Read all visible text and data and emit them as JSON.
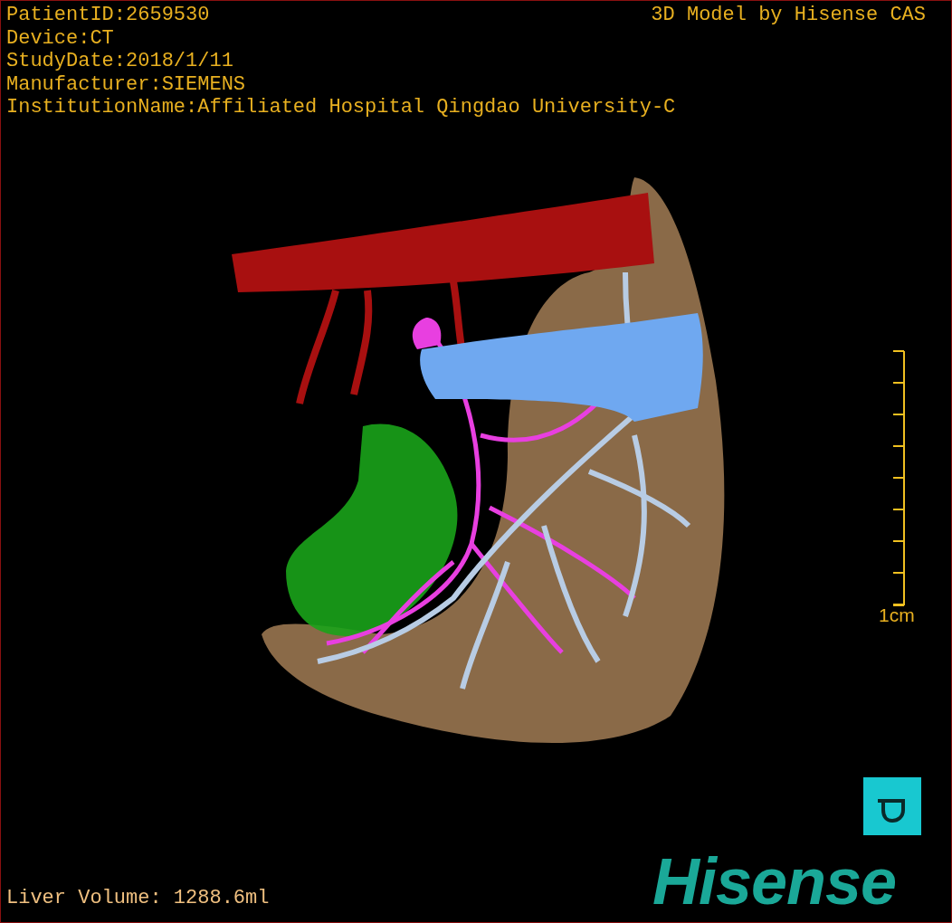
{
  "info_lines": [
    "PatientID:2659530",
    "Device:CT",
    "StudyDate:2018/1/11",
    "Manufacturer:SIEMENS",
    "InstitutionName:Affiliated Hospital Qingdao University-C"
  ],
  "credit": "3D Model by Hisense CAS",
  "scale_bar": {
    "label": "1cm"
  },
  "liver_volume": "Liver Volume: 1288.6ml",
  "logo": "Hisense"
}
